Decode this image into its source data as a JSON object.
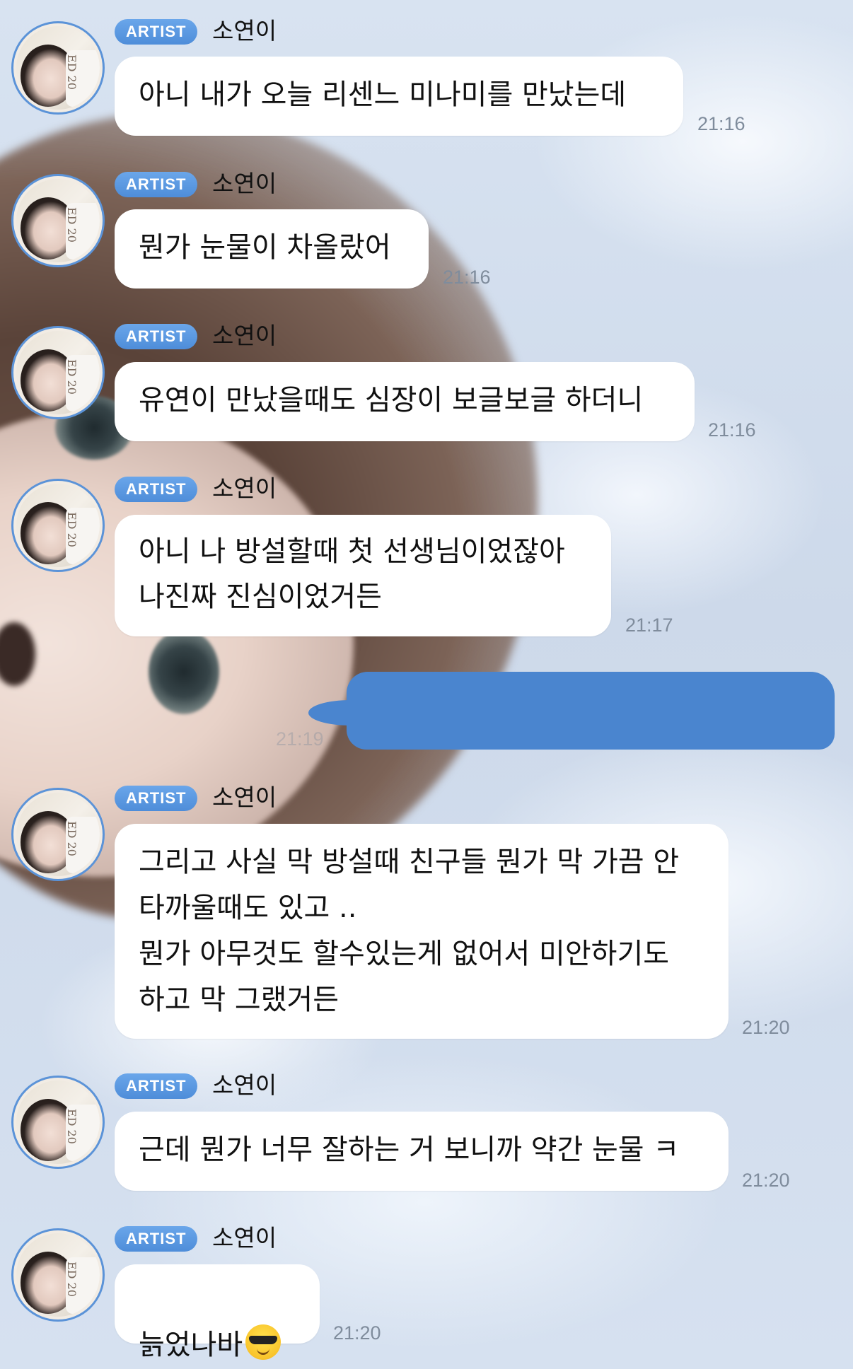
{
  "messages": [
    {
      "badge": "ARTIST",
      "name": "소연이",
      "text": "아니 내가 오늘 리센느 미나미를 만났는데",
      "time": "21:16"
    },
    {
      "badge": "ARTIST",
      "name": "소연이",
      "text": "뭔가 눈물이 차올랐어",
      "time": "21:16"
    },
    {
      "badge": "ARTIST",
      "name": "소연이",
      "text": "유연이 만났을때도 심장이 보글보글 하더니",
      "time": "21:16"
    },
    {
      "badge": "ARTIST",
      "name": "소연이",
      "text": "아니 나 방설할때 첫 선생님이었잖아\n나진짜 진심이었거든",
      "time": "21:17"
    },
    {
      "badge": "ARTIST",
      "name": "소연이",
      "text": "그리고 사실 막 방설때 친구들 뭔가 막 가끔 안\n타까울때도 있고 ..\n뭔가 아무것도 할수있는게 없어서 미안하기도\n하고 막 그랬거든",
      "time": "21:20"
    },
    {
      "badge": "ARTIST",
      "name": "소연이",
      "text": "근데 뭔가 너무 잘하는 거 보니까 약간 눈물 ㅋ",
      "time": "21:20"
    },
    {
      "badge": "ARTIST",
      "name": "소연이",
      "text": "늙었나바",
      "emoji": "sunglasses-emoji",
      "time": "21:20"
    }
  ],
  "redacted_message": {
    "time": "21:19"
  },
  "avatar": {
    "watermark": "ED 20"
  },
  "colors": {
    "badge": "#5b97e0",
    "bubble": "#ffffff",
    "outgoing": "#4a85cf",
    "time": "#7f8c9c"
  }
}
